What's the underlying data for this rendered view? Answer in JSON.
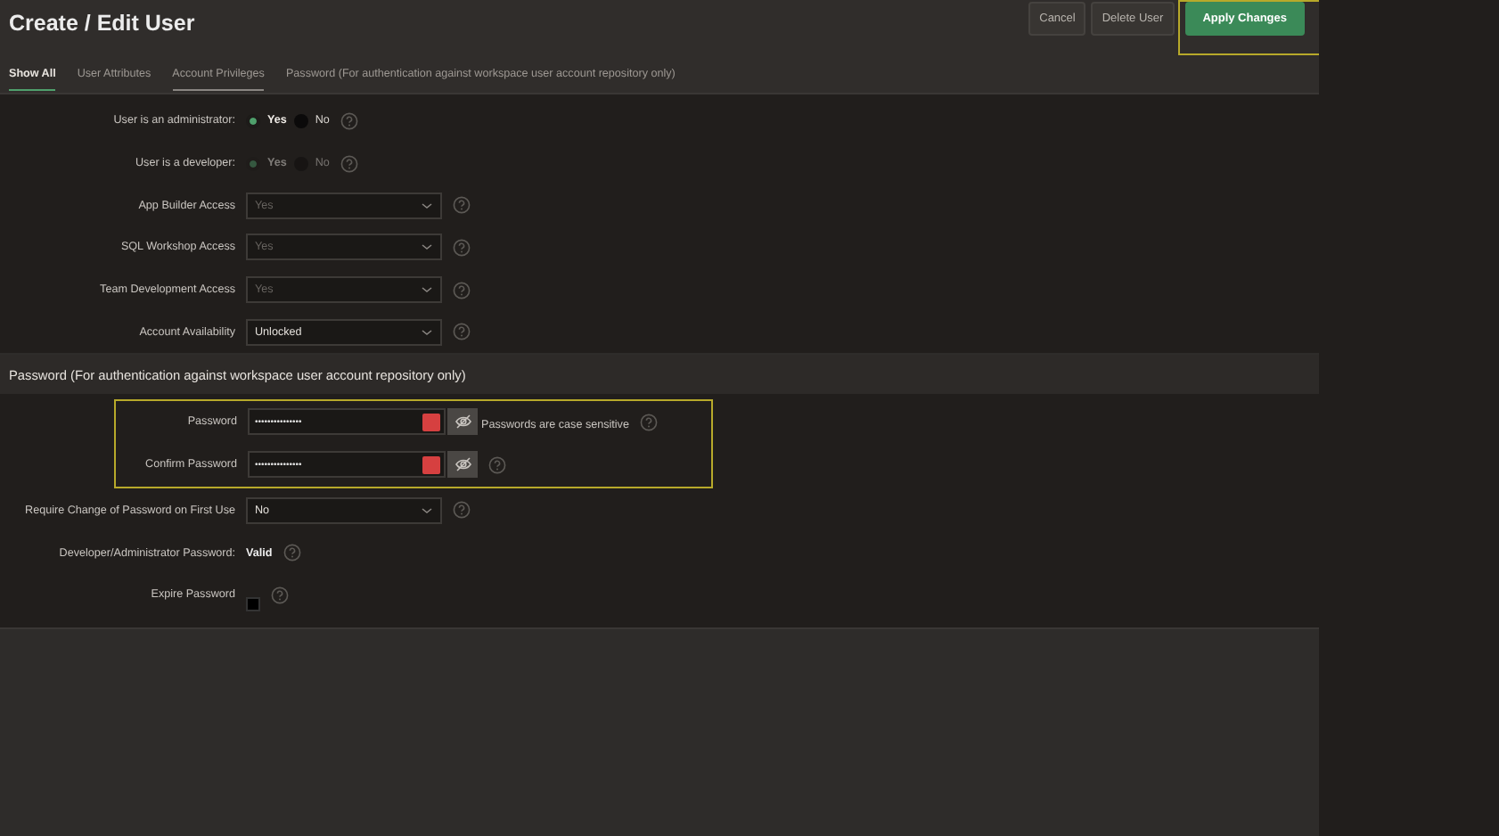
{
  "header": {
    "title": "Create / Edit User",
    "buttons": [
      {
        "label": "Cancel",
        "kind": "secondary",
        "highlighted": false
      },
      {
        "label": "Delete User",
        "kind": "secondary",
        "highlighted": false
      },
      {
        "label": "Apply Changes",
        "kind": "primary",
        "highlighted": true
      }
    ]
  },
  "tabs": [
    {
      "label": "Show All",
      "selected": true,
      "hovered": false
    },
    {
      "label": "User Attributes",
      "selected": false,
      "hovered": false
    },
    {
      "label": "Account Privileges",
      "selected": false,
      "hovered": true
    },
    {
      "label": "Password (For authentication against workspace user account repository only)",
      "selected": false,
      "hovered": false
    }
  ],
  "privileges": [
    {
      "kind": "radio",
      "label": "User is an administrator:",
      "disabled": false,
      "options": [
        {
          "label": "Yes",
          "selected": true
        },
        {
          "label": "No",
          "selected": false
        }
      ]
    },
    {
      "kind": "radio",
      "label": "User is a developer:",
      "disabled": true,
      "options": [
        {
          "label": "Yes",
          "selected": true
        },
        {
          "label": "No",
          "selected": false
        }
      ]
    },
    {
      "kind": "select",
      "label": "App Builder Access",
      "value": "Yes",
      "disabled": true
    },
    {
      "kind": "select",
      "label": "SQL Workshop Access",
      "value": "Yes",
      "disabled": true
    },
    {
      "kind": "select",
      "label": "Team Development Access",
      "value": "Yes",
      "disabled": true
    },
    {
      "kind": "select",
      "label": "Account Availability",
      "value": "Unlocked",
      "disabled": false
    }
  ],
  "password_section": {
    "heading": "Password (For authentication against workspace user account repository only)",
    "group": {
      "highlighted": true,
      "fields": [
        {
          "kind": "password",
          "label": "Password",
          "value": "•••••••••••••••",
          "note": "Passwords are case sensitive"
        },
        {
          "kind": "password",
          "label": "Confirm Password",
          "value": "•••••••••••••••"
        }
      ]
    },
    "fields": [
      {
        "kind": "select",
        "label": "Require Change of Password on First Use",
        "value": "No",
        "disabled": false
      },
      {
        "kind": "text",
        "label": "Developer/Administrator Password:",
        "value": "Valid"
      },
      {
        "kind": "checkbox",
        "label": "Expire Password",
        "checked": false
      }
    ]
  }
}
